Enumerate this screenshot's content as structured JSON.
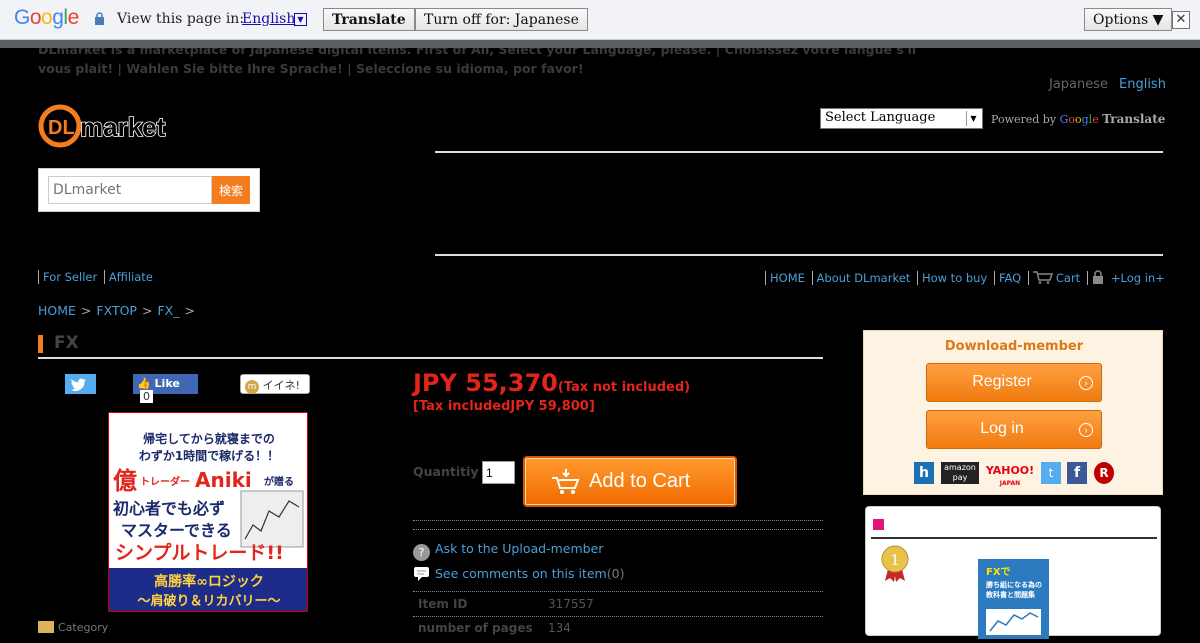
{
  "translate_bar": {
    "logo": "Google",
    "prompt": "View this page in:",
    "language": "English",
    "translate_btn": "Translate",
    "turn_off_btn": "Turn off for: Japanese",
    "options_btn": "Options ▼",
    "close": "✕"
  },
  "notice": "DLmarket is a marketplace of Japanese digital items. First of All, Select your Language, please. | Choisissez votre langue s'il vous plait! | Wahlen Sie bitte Ihre Sprache! | Seleccione su idioma, por favor!",
  "header": {
    "lang_japanese": "Japanese",
    "lang_english": "English",
    "select_language": "Select Language",
    "powered_by": "Powered by",
    "translate": "Translate",
    "search_placeholder": "DLmarket",
    "search_btn": "検索"
  },
  "nav_left": {
    "for_seller": "For Seller",
    "affiliate": "Affiliate"
  },
  "nav_right": {
    "home": "HOME",
    "about": "About DLmarket",
    "how_to_buy": "How to buy",
    "faq": "FAQ",
    "cart": "Cart",
    "login": "+Log in+"
  },
  "breadcrumb": {
    "home": "HOME",
    "fxtop": "FXTOP",
    "fx": "FX_",
    "sep": ">"
  },
  "product": {
    "title": "FX",
    "fb_like": "Like",
    "fb_count": "0",
    "mixi": "イイネ!",
    "image_text": {
      "line1": "帰宅してから就寝までの",
      "line2": "わずか1時間で稼げる！！",
      "line3a": "億",
      "line3b": "トレーダー",
      "line3c": "Aniki",
      "line3d": "が贈る",
      "line4": "初心者でも必ず",
      "line5": "マスターできる",
      "line6": "シンプルトレード!!",
      "line7": "高勝率∞ロジック",
      "line8": "～肩破り＆リカバリー～"
    },
    "price": "JPY 55,370",
    "tax_not_included": "(Tax not included)",
    "tax_included": "[Tax includedJPY 59,800]",
    "quantity_label": "Quantitiy",
    "quantity_value": "1",
    "add_to_cart": "Add to Cart",
    "ask": "Ask to the Upload-member",
    "comments": "See comments on this item",
    "comments_count": "(0)",
    "item_id_label": "Item ID",
    "item_id": "317557",
    "pages_label": "number of pages",
    "pages": "134",
    "category_label": "Category"
  },
  "sidebar": {
    "title": "Download-member",
    "register": "Register",
    "login": "Log in",
    "amazon": "amazon",
    "pay": "pay",
    "yahoo": "YAHOO!",
    "yahoo_sub": "JAPAN",
    "book_line1": "FXで",
    "book_line2": "勝ち組になる為の",
    "book_line3": "教科書と問題集"
  },
  "colors": {
    "accent": "#f47d1f",
    "link": "#4a9fd8",
    "price": "#e3241b"
  }
}
